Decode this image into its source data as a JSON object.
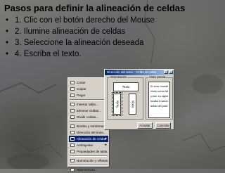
{
  "slide": {
    "heading": "Pasos para definir la alineación de celdas",
    "bullet": "•",
    "steps": [
      "1. Clic con el botón derecho del Mouse",
      "2. Ilumine alineación de celdas",
      "3. Seleccione la alineación deseada",
      "4. Escriba el texto."
    ]
  },
  "context_menu": {
    "items": [
      {
        "label": "Cortar"
      },
      {
        "label": "Copiar"
      },
      {
        "label": "Pegar"
      },
      {
        "sep": true
      },
      {
        "label": "Insertar tabla..."
      },
      {
        "label": "Eliminar celdas..."
      },
      {
        "label": "Dividir celdas..."
      },
      {
        "sep": true
      },
      {
        "label": "Bordes y sombreado..."
      },
      {
        "label": "Dirección del texto..."
      },
      {
        "label": "Alineación de celdas",
        "selected": true,
        "submenu": true
      },
      {
        "label": "Autoajustar",
        "submenu": true
      },
      {
        "label": "Propiedades de tabla..."
      },
      {
        "sep": true
      },
      {
        "label": "Numeración y viñetas..."
      },
      {
        "sep": true
      },
      {
        "label": "Hipervínculo..."
      }
    ],
    "submenu_arrow": "▸"
  },
  "dialog": {
    "title": "Dirección del texto - Celda de tabla",
    "help_btn": "?",
    "close_btn": "×",
    "orientation_label": "Orientación",
    "horizontal_text": "Texto",
    "vertical_left_text": "Texto",
    "vertical_right_text": "Texto",
    "preview_label": "Vista previa",
    "preview_lines": [
      "El veloz murciélago",
      "hindú comía feliz cardillo",
      "y kiwi. La cigüeña",
      "tocaba el saxofón",
      "detrás del palenque de"
    ],
    "ok_label": "Aceptar",
    "cancel_label": "Cancelar"
  }
}
